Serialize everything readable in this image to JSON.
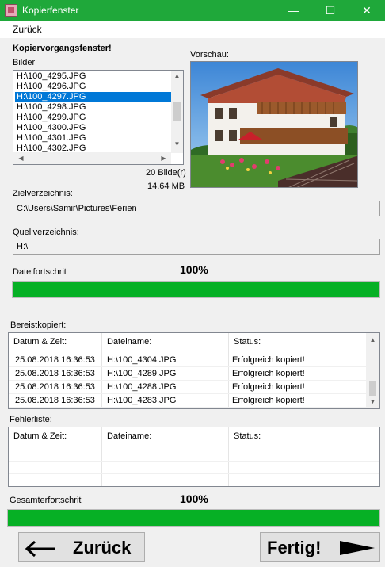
{
  "window": {
    "title": "Kopierfenster",
    "minimize_glyph": "—",
    "maximize_glyph": "☐",
    "close_glyph": "✕",
    "accent": "#1fa83a"
  },
  "menu": {
    "back": "Zurück"
  },
  "heading": "Kopiervorgangsfenster!",
  "images": {
    "label": "Bilder",
    "items": [
      "H:\\100_4295.JPG",
      "H:\\100_4296.JPG",
      "H:\\100_4297.JPG",
      "H:\\100_4298.JPG",
      "H:\\100_4299.JPG",
      "H:\\100_4300.JPG",
      "H:\\100_4301.JPG",
      "H:\\100_4302.JPG"
    ],
    "selected_index": 2,
    "count_text": "20 Bilde(r)",
    "size_text": "14.64 MB"
  },
  "preview": {
    "label": "Vorschau:"
  },
  "target": {
    "label": "Zielverzeichnis:",
    "value": "C:\\Users\\Samir\\Pictures\\Ferien"
  },
  "source": {
    "label": "Quellverzeichnis:",
    "value": "H:\\"
  },
  "file_progress": {
    "label": "Dateifortschrit",
    "percent_text": "100%",
    "value": 1.0
  },
  "copied": {
    "label": "Bereistkopiert:",
    "columns": [
      "Datum & Zeit:",
      "Dateiname:",
      "Status:"
    ],
    "rows": [
      [
        "25.08.2018 16:36:53",
        "H:\\100_4304.JPG",
        "Erfolgreich kopiert!"
      ],
      [
        "25.08.2018 16:36:53",
        "H:\\100_4289.JPG",
        "Erfolgreich kopiert!"
      ],
      [
        "25.08.2018 16:36:53",
        "H:\\100_4288.JPG",
        "Erfolgreich kopiert!"
      ],
      [
        "25.08.2018 16:36:53",
        "H:\\100_4283.JPG",
        "Erfolgreich kopiert!"
      ]
    ]
  },
  "errors": {
    "label": "Fehlerliste:",
    "columns": [
      "Datum & Zeit:",
      "Dateiname:",
      "Status:"
    ]
  },
  "total_progress": {
    "label": "Gesamterfortschrit",
    "percent_text": "100%",
    "value": 1.0
  },
  "buttons": {
    "back": "Zurück",
    "finish": "Fertig!"
  }
}
